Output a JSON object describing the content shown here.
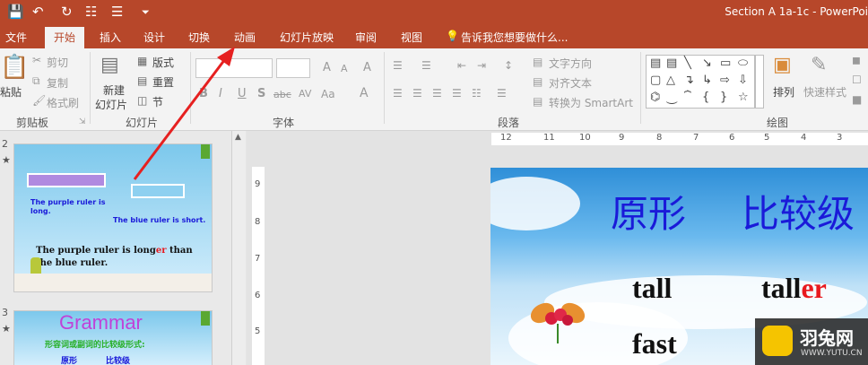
{
  "titlebar": {
    "title": "Section A 1a-1c - PowerPoi"
  },
  "tabs": [
    "文件",
    "开始",
    "插入",
    "设计",
    "切换",
    "动画",
    "幻灯片放映",
    "审阅",
    "视图"
  ],
  "tell_me": "告诉我您想要做什么...",
  "ribbon": {
    "clipboard": {
      "paste": "粘贴",
      "cut": "剪切",
      "copy": "复制",
      "format_painter": "格式刷",
      "label": "剪贴板"
    },
    "slides": {
      "new_slide_1": "新建",
      "new_slide_2": "幻灯片",
      "layout": "版式",
      "reset": "重置",
      "section": "节",
      "label": "幻灯片"
    },
    "font": {
      "grow": "A",
      "shrink": "A",
      "clear": "A",
      "bold": "B",
      "italic": "I",
      "underline": "U",
      "strike": "S",
      "abc": "abc",
      "spacing": "AV",
      "case": "Aa",
      "color": "A",
      "label": "字体"
    },
    "paragraph": {
      "text_direction": "文字方向",
      "align_text": "对齐文本",
      "smartart": "转换为 SmartArt",
      "label": "段落"
    },
    "drawing": {
      "arrange": "排列",
      "quick_styles": "快速样式",
      "label": "绘图"
    }
  },
  "thumbnails": [
    {
      "number": "2",
      "text1": "The purple ruler is long.",
      "text2": "The blue ruler is short.",
      "text3a": "The purple ruler is long",
      "text3b": "er",
      "text3c": " than the blue ruler."
    },
    {
      "number": "3",
      "title": "Grammar",
      "subtitle": "形容词或副词的比较级形式:",
      "col1": "原形",
      "col2": "比较级"
    }
  ],
  "hruler_ticks": [
    "12",
    "11",
    "10",
    "9",
    "8",
    "7",
    "6",
    "5",
    "4",
    "3"
  ],
  "vruler_ticks": [
    "9",
    "8",
    "7",
    "6",
    "5"
  ],
  "slide": {
    "heading1": "原形",
    "heading2": "比较级",
    "word1": "tall",
    "word2a": "tall",
    "word2b": "er",
    "word3": "fast"
  },
  "watermark": {
    "brand": "羽兔网",
    "url": "WWW.YUTU.CN"
  },
  "colors": {
    "accent": "#b7472a",
    "slide_heading": "#1a1ad9",
    "highlight": "#e8191e"
  }
}
